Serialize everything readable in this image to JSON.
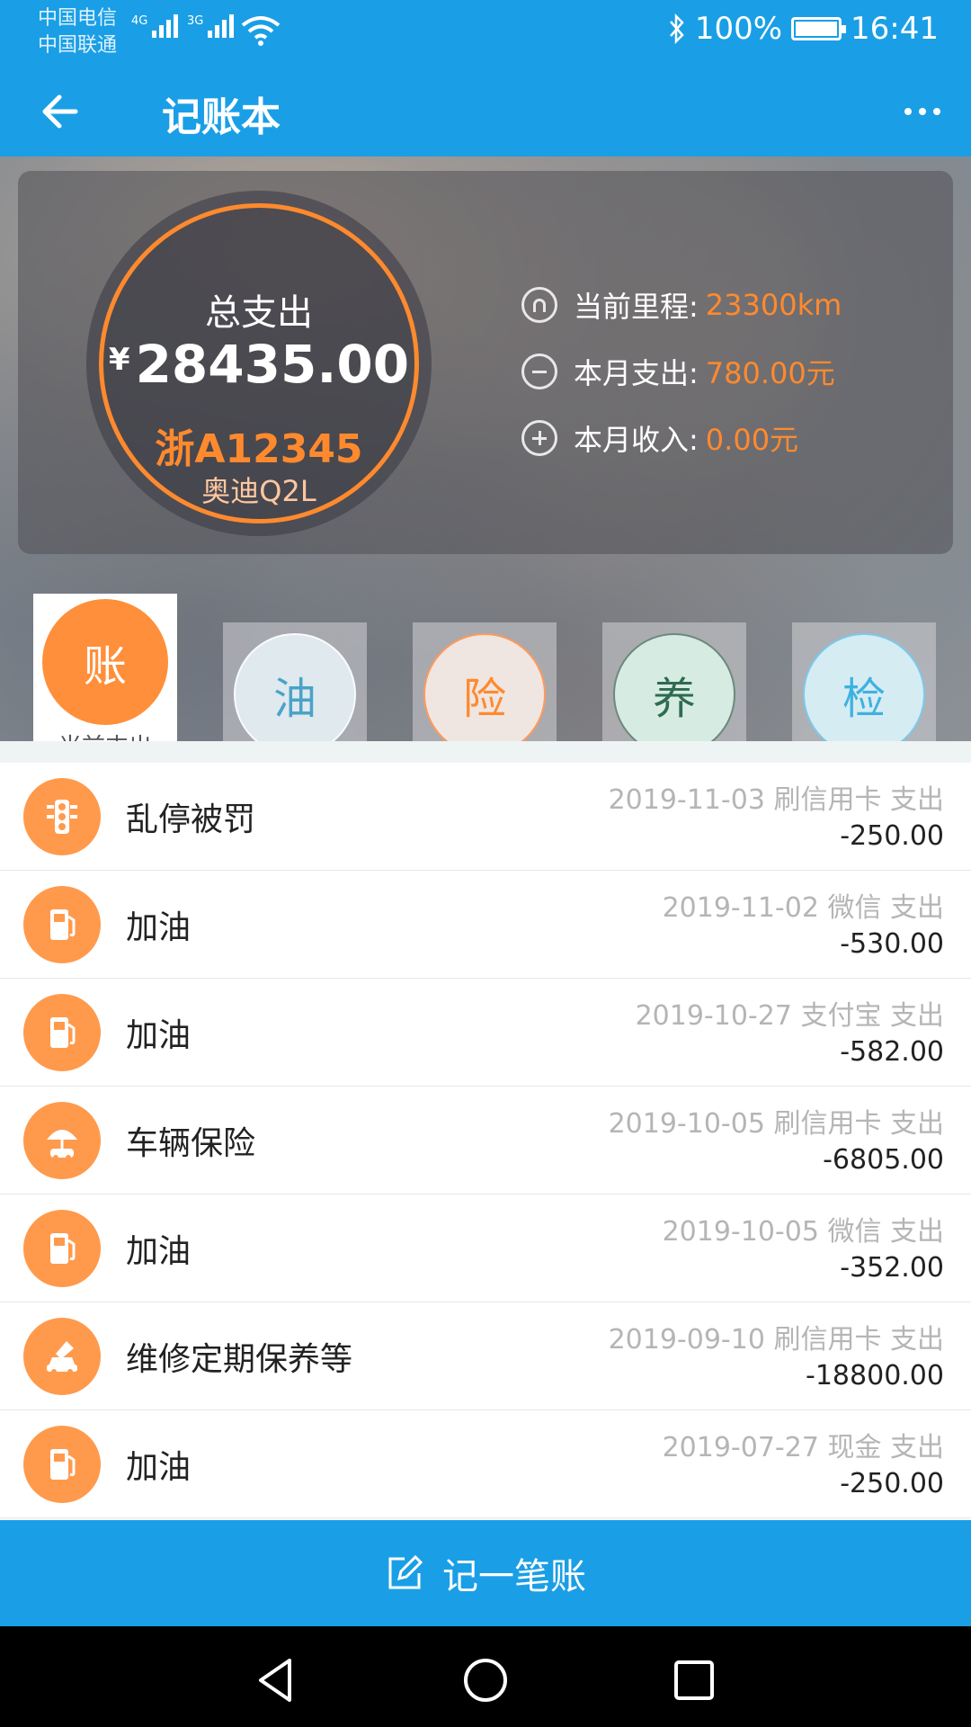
{
  "status_bar": {
    "carrier_1": "中国电信",
    "carrier_2": "中国联通",
    "net_1": "4G",
    "net_2": "3G",
    "battery": "100%",
    "time": "16:41"
  },
  "app_bar": {
    "title": "记账本"
  },
  "summary": {
    "total_label": "总支出",
    "currency": "¥",
    "total_amount": "28435.00",
    "plate": "浙A12345",
    "model": "奥迪Q2L",
    "stats": [
      {
        "label": "当前里程:",
        "value": "23300km",
        "icon": "odometer-icon"
      },
      {
        "label": "本月支出:",
        "value": "780.00元",
        "icon": "minus-circle-icon"
      },
      {
        "label": "本月收入:",
        "value": "0.00元",
        "icon": "plus-circle-icon"
      }
    ]
  },
  "tabs": [
    {
      "char": "账",
      "caption": "当前支出",
      "active": true
    },
    {
      "char": "油",
      "color": "#4aa3c8",
      "bg": "#dfe9ee"
    },
    {
      "char": "险",
      "color": "#ff8a2e",
      "bg": "#efe6e2"
    },
    {
      "char": "养",
      "color": "#2e6b52",
      "bg": "#d6ece2"
    },
    {
      "char": "检",
      "color": "#3fb1e0",
      "bg": "#d6ecf3"
    }
  ],
  "records": [
    {
      "name": "乱停被罚",
      "meta": "2019-11-03 刷信用卡 支出",
      "amount": "-250.00",
      "icon": "traffic-light-icon"
    },
    {
      "name": "加油",
      "meta": "2019-11-02 微信 支出",
      "amount": "-530.00",
      "icon": "fuel-pump-icon"
    },
    {
      "name": "加油",
      "meta": "2019-10-27 支付宝 支出",
      "amount": "-582.00",
      "icon": "fuel-pump-icon"
    },
    {
      "name": "车辆保险",
      "meta": "2019-10-05 刷信用卡 支出",
      "amount": "-6805.00",
      "icon": "car-insurance-icon"
    },
    {
      "name": "加油",
      "meta": "2019-10-05 微信 支出",
      "amount": "-352.00",
      "icon": "fuel-pump-icon"
    },
    {
      "name": "维修定期保养等",
      "meta": "2019-09-10 刷信用卡 支出",
      "amount": "-18800.00",
      "icon": "car-repair-icon"
    },
    {
      "name": "加油",
      "meta": "2019-07-27 现金 支出",
      "amount": "-250.00",
      "icon": "fuel-pump-icon"
    }
  ],
  "action": {
    "label": "记一笔账"
  },
  "colors": {
    "primary": "#1a9fe6",
    "accent": "#ff8a2e"
  }
}
